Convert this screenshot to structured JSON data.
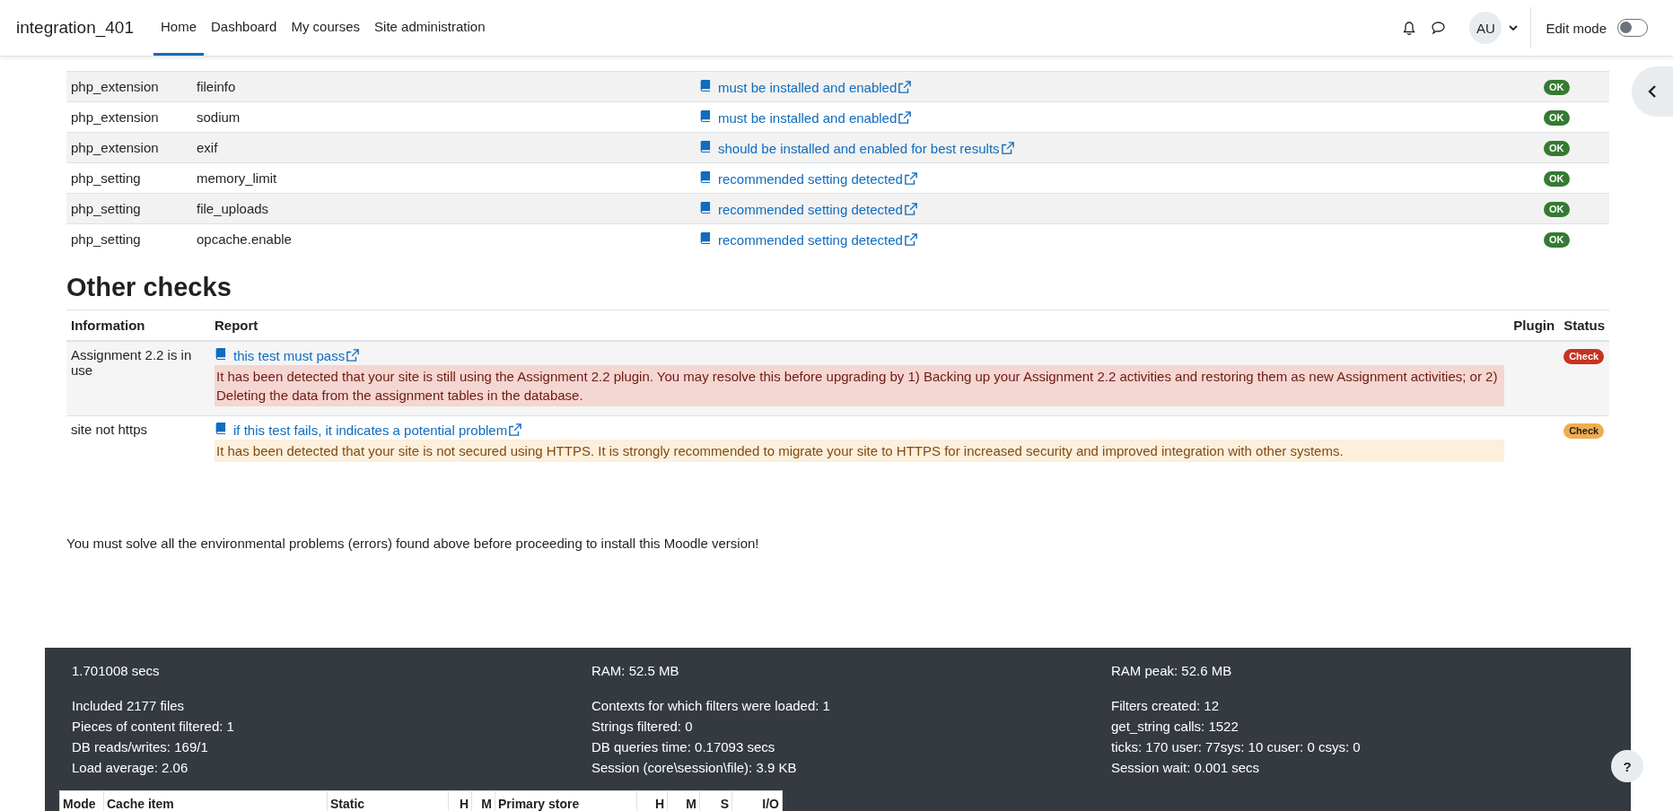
{
  "navbar": {
    "brand": "integration_401",
    "items": [
      {
        "label": "Home",
        "selected": true
      },
      {
        "label": "Dashboard",
        "selected": false
      },
      {
        "label": "My courses",
        "selected": false
      },
      {
        "label": "Site administration",
        "selected": false
      }
    ],
    "avatar": "AU",
    "edit_mode": {
      "label": "Edit mode",
      "on": false
    }
  },
  "environment_rows": [
    {
      "type": "php_extension",
      "name": "fileinfo",
      "report": "must be installed and enabled",
      "status": {
        "label": "OK",
        "kind": "ok"
      }
    },
    {
      "type": "php_extension",
      "name": "sodium",
      "report": "must be installed and enabled",
      "status": {
        "label": "OK",
        "kind": "ok"
      }
    },
    {
      "type": "php_extension",
      "name": "exif",
      "report": "should be installed and enabled for best results",
      "status": {
        "label": "OK",
        "kind": "ok"
      }
    },
    {
      "type": "php_setting",
      "name": "memory_limit",
      "report": "recommended setting detected",
      "status": {
        "label": "OK",
        "kind": "ok"
      }
    },
    {
      "type": "php_setting",
      "name": "file_uploads",
      "report": "recommended setting detected",
      "status": {
        "label": "OK",
        "kind": "ok"
      }
    },
    {
      "type": "php_setting",
      "name": "opcache.enable",
      "report": "recommended setting detected",
      "status": {
        "label": "OK",
        "kind": "ok"
      }
    }
  ],
  "other_checks": {
    "title": "Other checks",
    "columns": [
      "Information",
      "Report",
      "Plugin",
      "Status"
    ],
    "rows": [
      {
        "information": "Assignment 2.2 is in use",
        "report": "this test must pass",
        "message": "It has been detected that your site is still using the Assignment 2.2 plugin. You may resolve this before upgrading by 1) Backing up your Assignment 2.2 activities and restoring them as new Assignment activities; or 2) Deleting the data from the assignment tables in the database.",
        "status": {
          "label": "Check",
          "kind": "error"
        }
      },
      {
        "information": "site not https",
        "report": "if this test fails, it indicates a potential problem",
        "message": "It has been detected that your site is not secured using HTTPS. It is strongly recommended to migrate your site to HTTPS for increased security and improved integration with other systems.",
        "status": {
          "label": "Check",
          "kind": "warning"
        }
      }
    ]
  },
  "notice": "You must solve all the environmental problems (errors) found above before proceeding to install this Moodle version!",
  "footer": {
    "columns": [
      {
        "headline": "1.701008 secs",
        "lines": [
          "Included 2177 files",
          "Pieces of content filtered: 1",
          "DB reads/writes: 169/1",
          "Load average: 2.06"
        ]
      },
      {
        "headline": "RAM: 52.5 MB",
        "lines": [
          "Contexts for which filters were loaded: 1",
          "Strings filtered: 0",
          "DB queries time: 0.17093 secs",
          "Session (core\\session\\file): 3.9 KB"
        ]
      },
      {
        "headline": "RAM peak: 52.6 MB",
        "lines": [
          "Filters created: 12",
          "get_string calls: 1522",
          "ticks: 170 user: 77sys: 10 cuser: 0 csys: 0",
          "Session wait: 0.001 secs"
        ]
      }
    ],
    "cache_table": {
      "columns": [
        "Mode",
        "Cache item",
        "Static",
        "H",
        "M",
        "Primary store",
        "H",
        "M",
        "S",
        "I/O"
      ]
    }
  },
  "help_button": "?"
}
